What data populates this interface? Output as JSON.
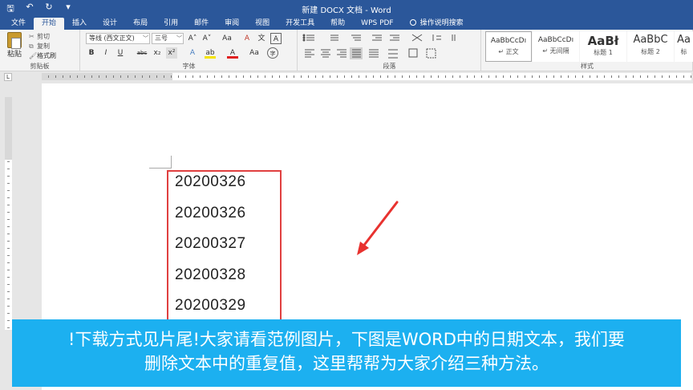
{
  "window": {
    "title": "新建 DOCX 文档 - Word"
  },
  "qat": {
    "save": "🖫",
    "undo": "↶",
    "redo": "↻",
    "more": "▾"
  },
  "tabs": [
    "文件",
    "开始",
    "插入",
    "设计",
    "布局",
    "引用",
    "邮件",
    "审阅",
    "视图",
    "开发工具",
    "帮助",
    "WPS PDF",
    "操作说明搜索"
  ],
  "ribbon": {
    "clipboard": {
      "paste": "粘贴",
      "cut": "剪切",
      "copy": "复制",
      "format_painter": "格式刷",
      "label": "剪贴板"
    },
    "font": {
      "name": "等线 (西文正文)",
      "size": "三号",
      "label": "字体",
      "grow": "A˄",
      "shrink": "A˅",
      "case": "Aa",
      "clear": "A",
      "wen": "文",
      "a_box": "A",
      "bold": "B",
      "italic": "I",
      "underline": "U",
      "strike": "abc",
      "sub": "x₂",
      "sup": "x²",
      "effects": "A",
      "highlight": "ab",
      "color": "A",
      "aa": "Aa",
      "circle": "字"
    },
    "paragraph": {
      "label": "段落"
    },
    "styles": {
      "label": "样式",
      "cards": [
        {
          "sample": "AaBbCcDı",
          "name": "↵ 正文"
        },
        {
          "sample": "AaBbCcDı",
          "name": "↵ 无间隔"
        },
        {
          "sample": "AaBł",
          "name": "标题 1"
        },
        {
          "sample": "AaBbC",
          "name": "标题 2"
        },
        {
          "sample": "Aa",
          "name": "标"
        }
      ]
    }
  },
  "ruler": {
    "tab_selector": "L"
  },
  "document": {
    "dates": [
      "20200326",
      "20200326",
      "20200327",
      "20200328",
      "20200329"
    ]
  },
  "caption": {
    "line1": "!下载方式见片尾!大家请看范例图片，下图是WORD中的日期文本，我们要",
    "line2": "删除文本中的重复值，这里帮帮为大家介绍三种方法。"
  },
  "colors": {
    "ribbon_blue": "#2b579a",
    "box_red": "#e04040",
    "caption_blue": "#1cb0f0"
  }
}
